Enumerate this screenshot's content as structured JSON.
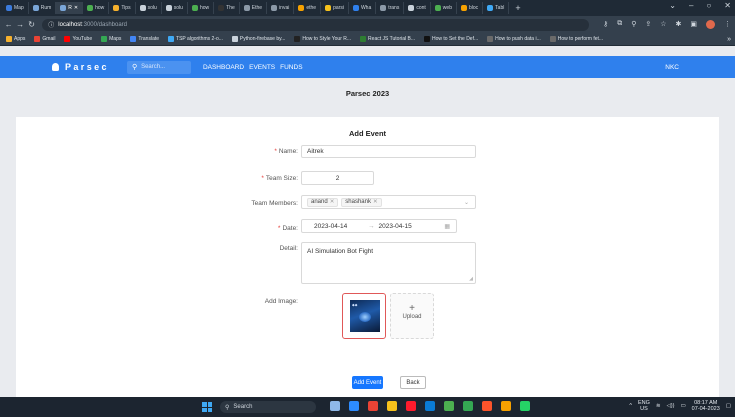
{
  "browser": {
    "tabs": [
      {
        "label": "Map",
        "color": "#3b7bdc"
      },
      {
        "label": "Rum",
        "color": "#7aa6d8"
      },
      {
        "label": "R",
        "color": "#7aa6d8",
        "active": true
      },
      {
        "label": "how",
        "color": "#4caf50"
      },
      {
        "label": "Tips",
        "color": "#f6b12d"
      },
      {
        "label": "solu",
        "color": "#c9d2db"
      },
      {
        "label": "solu",
        "color": "#c9d2db"
      },
      {
        "label": "how",
        "color": "#4caf50"
      },
      {
        "label": "The",
        "color": "#333333"
      },
      {
        "label": "Ethe",
        "color": "#8c9aa8"
      },
      {
        "label": "invai",
        "color": "#8c9aa8"
      },
      {
        "label": "ethe",
        "color": "#f6a100"
      },
      {
        "label": "parsi",
        "color": "#f6c21c"
      },
      {
        "label": "Wha",
        "color": "#2f80ed"
      },
      {
        "label": "trans",
        "color": "#8c9aa8"
      },
      {
        "label": "cont",
        "color": "#c9d2db"
      },
      {
        "label": "web",
        "color": "#4caf50"
      },
      {
        "label": "bloc",
        "color": "#f6a100"
      },
      {
        "label": "Tabl",
        "color": "#3fa9f5"
      }
    ],
    "tab_plus": "+",
    "address": {
      "host": "localhost",
      "path": ":3000/dashboard"
    },
    "bookmarks": [
      {
        "label": "Apps",
        "color": "#f6b12d"
      },
      {
        "label": "Gmail",
        "color": "#ea4335"
      },
      {
        "label": "YouTube",
        "color": "#ff0000"
      },
      {
        "label": "Maps",
        "color": "#34a853"
      },
      {
        "label": "Translate",
        "color": "#4285f4"
      },
      {
        "label": "TSP algorithms 2-o...",
        "color": "#3fa9f5"
      },
      {
        "label": "Python-firebase by...",
        "color": "#c9d2db"
      },
      {
        "label": "How to Style Your R...",
        "color": "#222222"
      },
      {
        "label": "React JS Tutorial B...",
        "color": "#2e7d32"
      },
      {
        "label": "How to Set the Def...",
        "color": "#111111"
      },
      {
        "label": "How to push data i...",
        "color": "#6a6a6a"
      },
      {
        "label": "How to perform fet...",
        "color": "#6a6a6a"
      }
    ],
    "bookmarks_more": "»"
  },
  "appbar": {
    "brand": "Parsec",
    "search_placeholder": "Search...",
    "links": [
      "DASHBOARD",
      "EVENTS",
      "FUNDS"
    ],
    "user": "NKC"
  },
  "page": {
    "title": "Parsec 2023"
  },
  "form": {
    "title": "Add Event",
    "name_label": "Name:",
    "name_value": "Aitrek",
    "team_size_label": "Team Size:",
    "team_size_value": "2",
    "members_label": "Team Members:",
    "members": [
      "anand",
      "shashank"
    ],
    "date_label": "Date:",
    "date_start": "2023-04-14",
    "date_sep": "→",
    "date_end": "2023-04-15",
    "detail_label": "Detail:",
    "detail_value": "AI Simulation Bot Fight",
    "image_label": "Add Image:",
    "upload_plus": "+",
    "upload_label": "Upload",
    "submit_label": "Add Event",
    "back_label": "Back"
  },
  "taskbar": {
    "search_label": "Search",
    "apps": [
      {
        "name": "file-explorer",
        "color": "#8fb8e8"
      },
      {
        "name": "zoom",
        "color": "#2d8cff"
      },
      {
        "name": "gmail",
        "color": "#ea4335"
      },
      {
        "name": "files",
        "color": "#f6c21c"
      },
      {
        "name": "opera",
        "color": "#ff1b2d"
      },
      {
        "name": "vscode",
        "color": "#0a7bd4"
      },
      {
        "name": "chrome",
        "color": "#4caf50"
      },
      {
        "name": "drive",
        "color": "#34a853"
      },
      {
        "name": "brave",
        "color": "#fb542b"
      },
      {
        "name": "game",
        "color": "#f6a100"
      },
      {
        "name": "whatsapp",
        "color": "#25d366"
      }
    ],
    "lang_top": "ENG",
    "lang_bottom": "US",
    "time": "08:17 AM",
    "date": "07-04-2023"
  }
}
